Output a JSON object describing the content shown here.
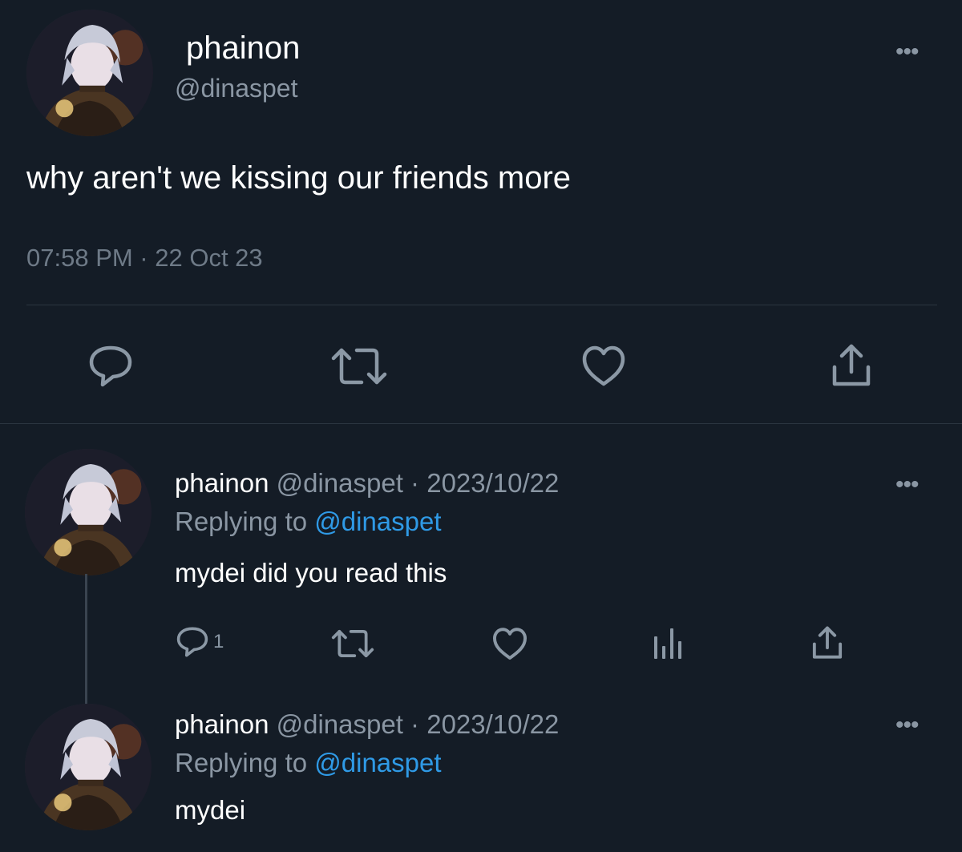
{
  "main": {
    "name": "phainon",
    "handle": "@dinaspet",
    "text": "why aren't we kissing our friends more",
    "timestamp": "07:58 PM · 22 Oct 23",
    "more": "•••"
  },
  "replies": [
    {
      "name": "phainon",
      "handle": "@dinaspet",
      "sep": " · ",
      "date": "2023/10/22",
      "replying_prefix": "Replying to ",
      "replying_to": "@dinaspet",
      "text": "mydei did you read this",
      "reply_count": "1",
      "more": "•••"
    },
    {
      "name": "phainon",
      "handle": "@dinaspet",
      "sep": " · ",
      "date": "2023/10/22",
      "replying_prefix": "Replying to ",
      "replying_to": "@dinaspet",
      "text": "mydei",
      "more": "•••"
    }
  ],
  "icons": [
    "reply-icon",
    "retweet-icon",
    "like-icon",
    "share-icon",
    "views-icon"
  ],
  "colors": {
    "background": "#141c26",
    "text": "#ffffff",
    "muted": "#8a96a3",
    "link": "#2f9ae6"
  }
}
